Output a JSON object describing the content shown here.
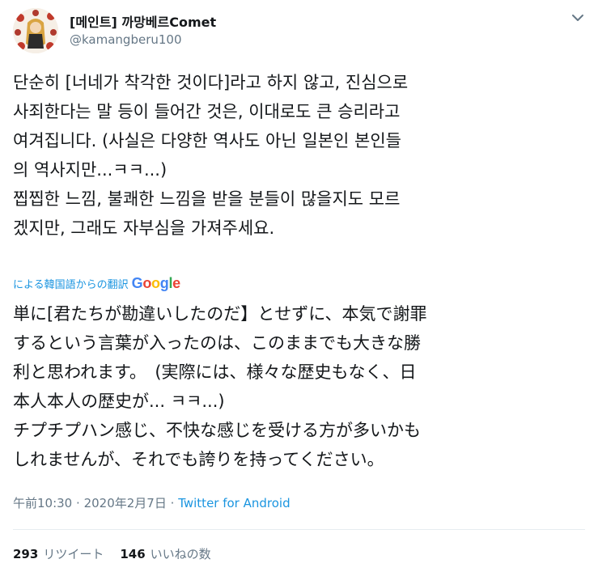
{
  "tweet": {
    "display_name": "[메인트] 까망베르Comet",
    "handle": "@kamangberu100",
    "text_ko": "단순히 [너네가 착각한 것이다]라고 하지 않고, 진심으로\n사죄한다는 말 등이 들어간 것은, 이대로도 큰 승리라고\n여겨집니다. (사실은 다양한 역사도 아닌 일본인 본인들\n의 역사지만...ㅋㅋ...)\n찝찝한 느낌, 불쾌한 느낌을 받을 분들이 많을지도 모르\n겠지만, 그래도 자부심을 가져주세요.",
    "translation_label": "による韓国語からの翻訳",
    "translation_provider": "Google",
    "text_ja": "単に[君たちが勘違いしたのだ】とせずに、本気で謝罪\nするという言葉が入ったのは、このままでも大きな勝\n利と思われます。　(実際には、様々な歴史もなく、日\n本人本人の歴史が... ㅋㅋ...)\nチプチプハン感じ、不快な感じを受ける方が多いかも\nしれませんが、それでも誇りを持ってください。",
    "time": "午前10:30",
    "separator": "·",
    "date": "2020年2月7日",
    "source": "Twitter for Android",
    "retweet_count": "293",
    "retweet_label": "リツイート",
    "like_count": "146",
    "like_label": "いいねの数"
  },
  "colors": {
    "text": "#14171a",
    "secondary": "#657786",
    "link": "#1b95e0",
    "divider": "#e6ecf0"
  },
  "icons": {
    "menu": "chevron-down-icon",
    "avatar": "avatar"
  }
}
